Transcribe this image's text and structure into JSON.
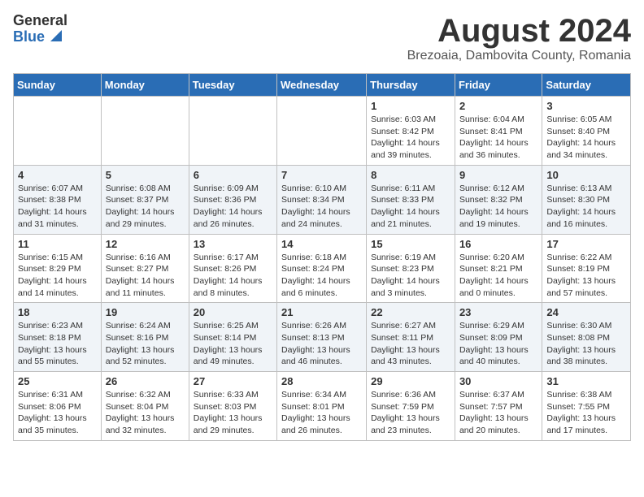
{
  "header": {
    "logo_general": "General",
    "logo_blue": "Blue",
    "title": "August 2024",
    "location": "Brezoaia, Dambovita County, Romania"
  },
  "weekdays": [
    "Sunday",
    "Monday",
    "Tuesday",
    "Wednesday",
    "Thursday",
    "Friday",
    "Saturday"
  ],
  "weeks": [
    [
      {
        "day": "",
        "info": ""
      },
      {
        "day": "",
        "info": ""
      },
      {
        "day": "",
        "info": ""
      },
      {
        "day": "",
        "info": ""
      },
      {
        "day": "1",
        "info": "Sunrise: 6:03 AM\nSunset: 8:42 PM\nDaylight: 14 hours and 39 minutes."
      },
      {
        "day": "2",
        "info": "Sunrise: 6:04 AM\nSunset: 8:41 PM\nDaylight: 14 hours and 36 minutes."
      },
      {
        "day": "3",
        "info": "Sunrise: 6:05 AM\nSunset: 8:40 PM\nDaylight: 14 hours and 34 minutes."
      }
    ],
    [
      {
        "day": "4",
        "info": "Sunrise: 6:07 AM\nSunset: 8:38 PM\nDaylight: 14 hours and 31 minutes."
      },
      {
        "day": "5",
        "info": "Sunrise: 6:08 AM\nSunset: 8:37 PM\nDaylight: 14 hours and 29 minutes."
      },
      {
        "day": "6",
        "info": "Sunrise: 6:09 AM\nSunset: 8:36 PM\nDaylight: 14 hours and 26 minutes."
      },
      {
        "day": "7",
        "info": "Sunrise: 6:10 AM\nSunset: 8:34 PM\nDaylight: 14 hours and 24 minutes."
      },
      {
        "day": "8",
        "info": "Sunrise: 6:11 AM\nSunset: 8:33 PM\nDaylight: 14 hours and 21 minutes."
      },
      {
        "day": "9",
        "info": "Sunrise: 6:12 AM\nSunset: 8:32 PM\nDaylight: 14 hours and 19 minutes."
      },
      {
        "day": "10",
        "info": "Sunrise: 6:13 AM\nSunset: 8:30 PM\nDaylight: 14 hours and 16 minutes."
      }
    ],
    [
      {
        "day": "11",
        "info": "Sunrise: 6:15 AM\nSunset: 8:29 PM\nDaylight: 14 hours and 14 minutes."
      },
      {
        "day": "12",
        "info": "Sunrise: 6:16 AM\nSunset: 8:27 PM\nDaylight: 14 hours and 11 minutes."
      },
      {
        "day": "13",
        "info": "Sunrise: 6:17 AM\nSunset: 8:26 PM\nDaylight: 14 hours and 8 minutes."
      },
      {
        "day": "14",
        "info": "Sunrise: 6:18 AM\nSunset: 8:24 PM\nDaylight: 14 hours and 6 minutes."
      },
      {
        "day": "15",
        "info": "Sunrise: 6:19 AM\nSunset: 8:23 PM\nDaylight: 14 hours and 3 minutes."
      },
      {
        "day": "16",
        "info": "Sunrise: 6:20 AM\nSunset: 8:21 PM\nDaylight: 14 hours and 0 minutes."
      },
      {
        "day": "17",
        "info": "Sunrise: 6:22 AM\nSunset: 8:19 PM\nDaylight: 13 hours and 57 minutes."
      }
    ],
    [
      {
        "day": "18",
        "info": "Sunrise: 6:23 AM\nSunset: 8:18 PM\nDaylight: 13 hours and 55 minutes."
      },
      {
        "day": "19",
        "info": "Sunrise: 6:24 AM\nSunset: 8:16 PM\nDaylight: 13 hours and 52 minutes."
      },
      {
        "day": "20",
        "info": "Sunrise: 6:25 AM\nSunset: 8:14 PM\nDaylight: 13 hours and 49 minutes."
      },
      {
        "day": "21",
        "info": "Sunrise: 6:26 AM\nSunset: 8:13 PM\nDaylight: 13 hours and 46 minutes."
      },
      {
        "day": "22",
        "info": "Sunrise: 6:27 AM\nSunset: 8:11 PM\nDaylight: 13 hours and 43 minutes."
      },
      {
        "day": "23",
        "info": "Sunrise: 6:29 AM\nSunset: 8:09 PM\nDaylight: 13 hours and 40 minutes."
      },
      {
        "day": "24",
        "info": "Sunrise: 6:30 AM\nSunset: 8:08 PM\nDaylight: 13 hours and 38 minutes."
      }
    ],
    [
      {
        "day": "25",
        "info": "Sunrise: 6:31 AM\nSunset: 8:06 PM\nDaylight: 13 hours and 35 minutes."
      },
      {
        "day": "26",
        "info": "Sunrise: 6:32 AM\nSunset: 8:04 PM\nDaylight: 13 hours and 32 minutes."
      },
      {
        "day": "27",
        "info": "Sunrise: 6:33 AM\nSunset: 8:03 PM\nDaylight: 13 hours and 29 minutes."
      },
      {
        "day": "28",
        "info": "Sunrise: 6:34 AM\nSunset: 8:01 PM\nDaylight: 13 hours and 26 minutes."
      },
      {
        "day": "29",
        "info": "Sunrise: 6:36 AM\nSunset: 7:59 PM\nDaylight: 13 hours and 23 minutes."
      },
      {
        "day": "30",
        "info": "Sunrise: 6:37 AM\nSunset: 7:57 PM\nDaylight: 13 hours and 20 minutes."
      },
      {
        "day": "31",
        "info": "Sunrise: 6:38 AM\nSunset: 7:55 PM\nDaylight: 13 hours and 17 minutes."
      }
    ]
  ]
}
